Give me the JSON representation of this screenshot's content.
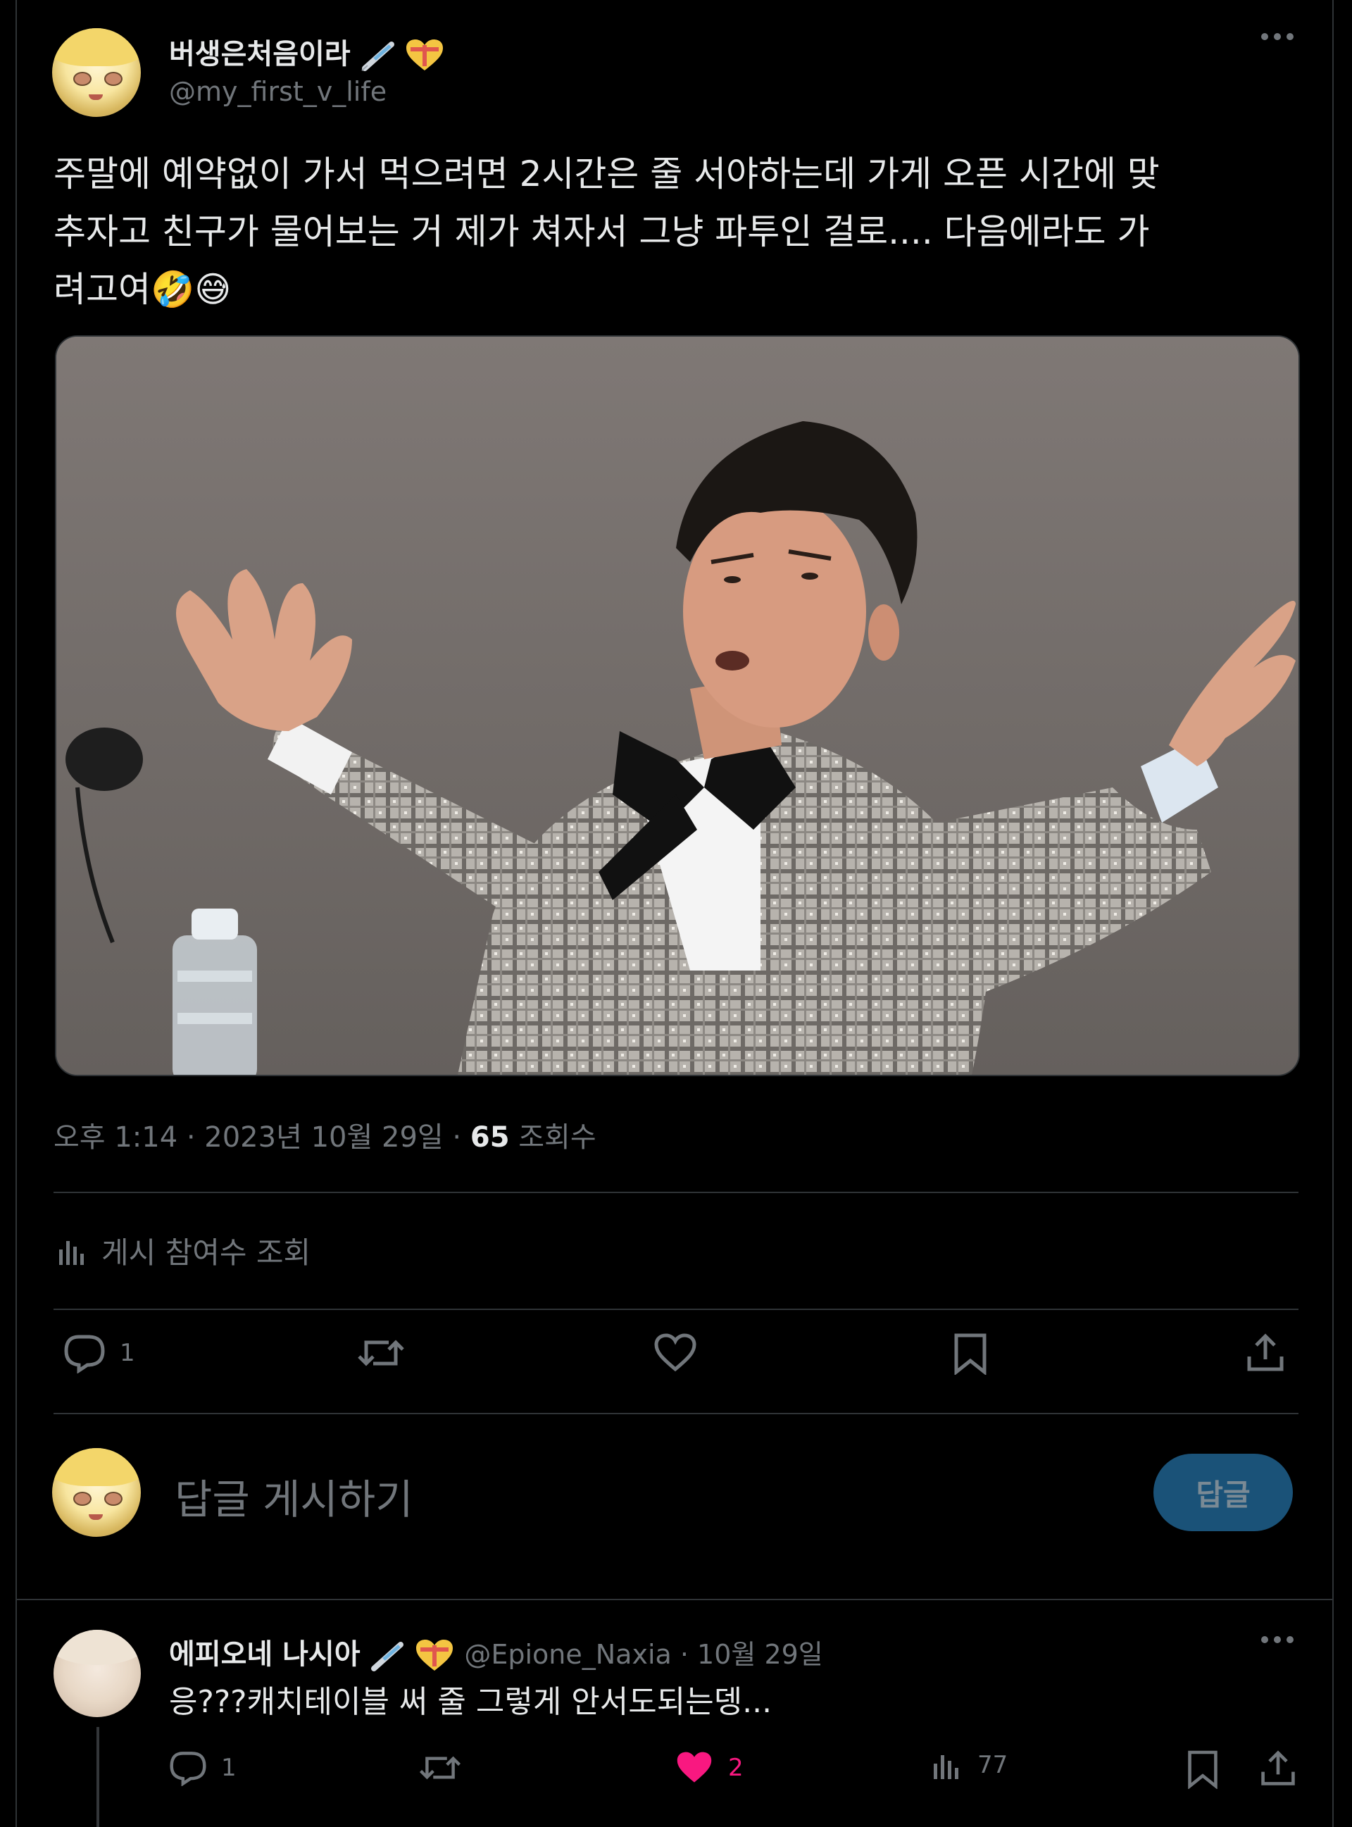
{
  "tweet": {
    "author_name": "버생은처음이라",
    "author_handle": "@my_first_v_life",
    "text_lines": [
      "주말에 예약없이 가서 먹으려면 2시간은 줄 서야하는데 가게 오픈 시간에 맞",
      "추자고 친구가 물어보는 거 제가 쳐자서 그냥 파투인 걸로.... 다음에라도 가",
      "려고여🤣😅"
    ],
    "meta_time": "오후 1:14 · 2023년 10월 29일 · ",
    "meta_views_count": "65",
    "meta_views_label": " 조회수",
    "analytics_label": "게시 참여수 조회",
    "reply_count": "1"
  },
  "composer": {
    "placeholder": "답글 게시하기",
    "button_label": "답글"
  },
  "reply": {
    "author_name": "에피오네 나시아",
    "author_handle": "@Epione_Naxia",
    "separator": " · ",
    "date": "10월 29일",
    "text": "응???캐치테이블 써 줄 그렇게 안서도되는뎅...",
    "reply_count": "1",
    "like_count": "2",
    "view_count": "77"
  },
  "colors": {
    "background": "#000000",
    "text": "#e7e9ea",
    "muted": "#71767b",
    "border": "#2f3336",
    "like_active": "#f91880",
    "reply_button": "#1a5278"
  },
  "icons": [
    "more-icon",
    "reply-icon",
    "retweet-icon",
    "like-icon",
    "bookmark-icon",
    "share-icon",
    "analytics-icon",
    "syringe-emoji",
    "heart-emoji"
  ]
}
